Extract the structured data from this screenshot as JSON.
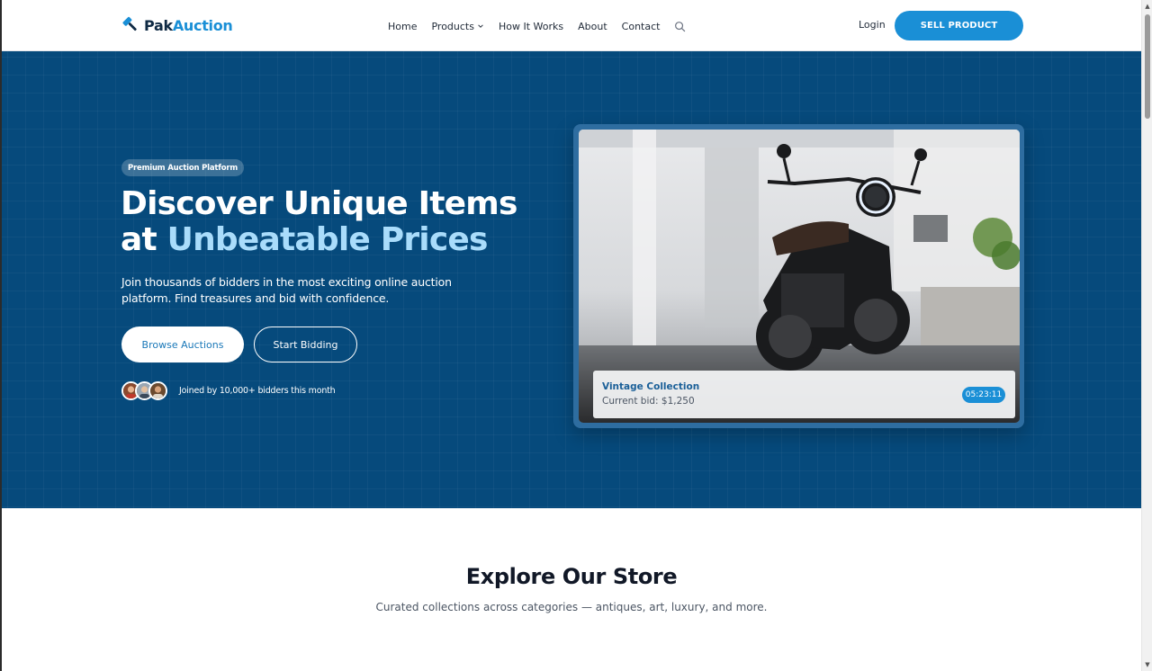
{
  "brand": {
    "name_part1": "Pak",
    "name_part2": "Auction"
  },
  "nav": {
    "links": [
      "Home",
      "Products",
      "How It Works",
      "About",
      "Contact"
    ],
    "login": "Login",
    "sell_button": "SELL PRODUCT"
  },
  "hero": {
    "badge": "Premium Auction Platform",
    "headline_line1": "Discover Unique Items",
    "headline_line2_prefix": "at ",
    "headline_line2_highlight": "Unbeatable Prices",
    "subtitle": "Join thousands of bidders in the most exciting online auction platform. Find treasures and bid with confidence.",
    "browse_button": "Browse Auctions",
    "start_button": "Start Bidding",
    "joined_text": "Joined by 10,000+ bidders this month",
    "card": {
      "title": "Vintage Collection",
      "current_bid": "Current bid: $1,250",
      "timer": "05:23:11"
    }
  },
  "explore": {
    "title": "Explore Our Store",
    "subtitle": "Curated collections across categories — antiques, art, luxury, and more."
  },
  "colors": {
    "hero_bg": "#064a7c",
    "accent": "#1a8fd6",
    "highlight_text": "#a9dcfb",
    "brand_dark": "#0f2a44"
  }
}
